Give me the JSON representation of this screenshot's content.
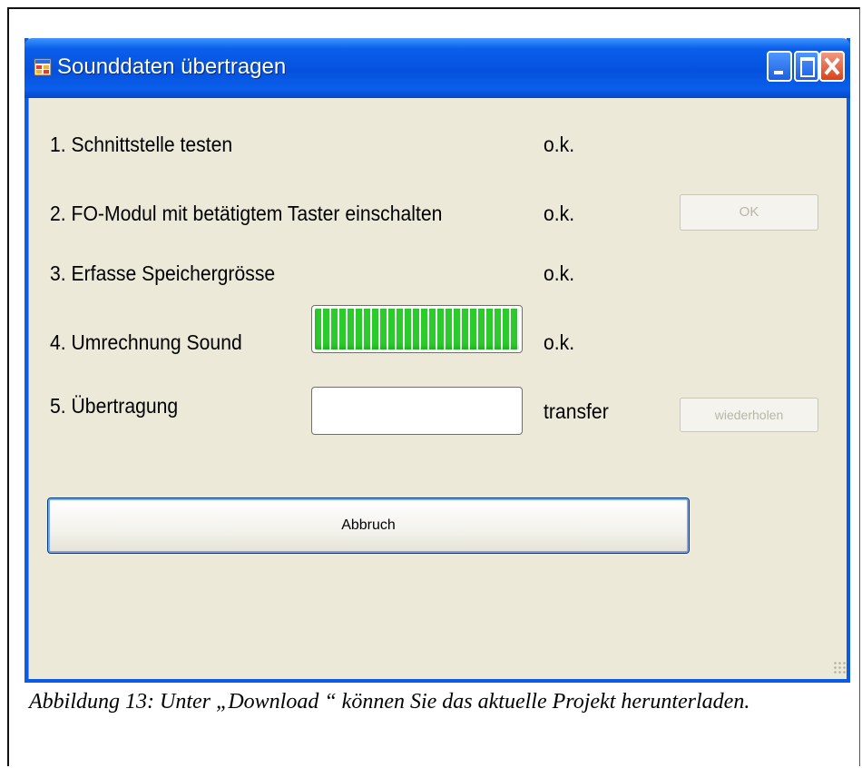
{
  "window": {
    "title": "Sounddaten übertragen"
  },
  "steps": [
    {
      "label": "1. Schnittstelle testen",
      "status": "o.k."
    },
    {
      "label": "2. FO-Modul mit betätigtem Taster einschalten",
      "status": "o.k.",
      "button_label": "OK"
    },
    {
      "label": "3. Erfasse Speichergrösse",
      "status": "o.k."
    },
    {
      "label": "4. Umrechnung Sound",
      "status": "o.k.",
      "progress_percent": 100
    },
    {
      "label": "5. Übertragung",
      "status": "transfer",
      "progress_percent": 0,
      "button_label": "wiederholen"
    }
  ],
  "cancel_label": "Abbruch",
  "caption": "Abbildung 13: Unter „Download “ können Sie das aktuelle Projekt herunterladen.",
  "colors": {
    "titlebar": "#0A5FEA",
    "dialog_bg": "#ECE9D8",
    "progress": "#2BCB2B",
    "close_button": "#D8421A"
  }
}
